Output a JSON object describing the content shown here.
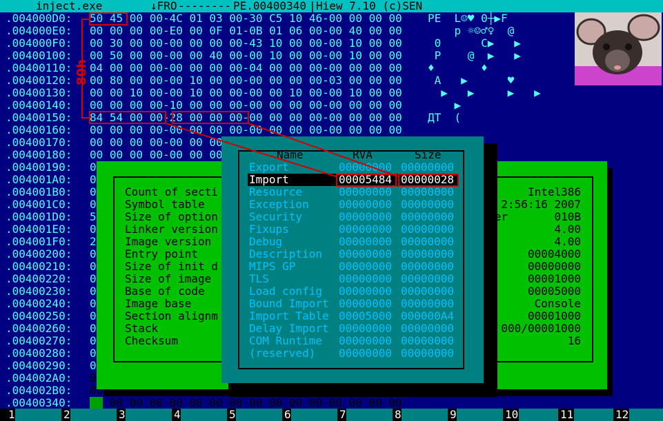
{
  "titlebar": {
    "file": "inject.exe",
    "mode": "↓FRO",
    "dashes": "--------",
    "position": "PE.00400340",
    "app": "Hiew 7.10 (c)SEN"
  },
  "hex_rows": [
    {
      "addr": ".004000D0:",
      "hex": "50 45 00 00-4C 01 03 00-30 C5 10 46-00 00 00 00",
      "ascii": "PE  L☺♥ 0┼▶F"
    },
    {
      "addr": ".004000E0:",
      "hex": "00 00 00 00-E0 00 0F 01-0B 01 06 00-00 40 00 00",
      "ascii": "    p ☼☺♂♀  @"
    },
    {
      "addr": ".004000F0:",
      "hex": "00 30 00 00-00 00 00 00-43 10 00 00-00 10 00 00",
      "ascii": " 0      C▶   ▶"
    },
    {
      "addr": ".00400100:",
      "hex": "00 50 00 00-00 00 40 00-00 10 00 00-00 10 00 00",
      "ascii": " P    @  ▶   ▶"
    },
    {
      "addr": ".00400110:",
      "hex": "04 00 00 00-00 00 00 00-04 00 00 00-00 00 00 00",
      "ascii": "♦       ♦"
    },
    {
      "addr": ".00400120:",
      "hex": "00 80 00 00-00 10 00 00-00 00 00 00-03 00 00 00",
      "ascii": " А   ▶      ♥"
    },
    {
      "addr": ".00400130:",
      "hex": "00 00 10 00-00 10 00 00-00 00 10 00-00 10 00 00",
      "ascii": "  ▶   ▶     ▶   ▶"
    },
    {
      "addr": ".00400140:",
      "hex": "00 00 00 00-10 00 00 00-00 00 00 00-00 00 00 00",
      "ascii": "    ▶"
    },
    {
      "addr": ".00400150:",
      "hex": "84 54 00 00-28 00 00 00-00 00 00 00-00 00 00 00",
      "ascii": "ДT  ("
    },
    {
      "addr": ".00400160:",
      "hex": "00 00 00 00-00 00 00 00-00 00 00 00-00 00 00 00",
      "ascii": ""
    },
    {
      "addr": ".00400170:",
      "hex": "00 00 00 00-00 00 00 00",
      "ascii": ""
    },
    {
      "addr": ".00400180:",
      "hex": "00 00 00 00-00 00 00 00",
      "ascii": ""
    },
    {
      "addr": ".00400190:",
      "hex": "0",
      "ascii": ""
    },
    {
      "addr": ".004001A0:",
      "hex": "0",
      "ascii": ""
    },
    {
      "addr": ".004001B0:",
      "hex": "0",
      "ascii": ""
    },
    {
      "addr": ".004001C0:",
      "hex": "0",
      "ascii": ""
    },
    {
      "addr": ".004001D0:",
      "hex": "5",
      "ascii": ""
    },
    {
      "addr": ".004001E0:",
      "hex": "0",
      "ascii": ""
    },
    {
      "addr": ".004001F0:",
      "hex": "2",
      "ascii": ""
    },
    {
      "addr": ".00400200:",
      "hex": "0",
      "ascii": ""
    },
    {
      "addr": ".00400210:",
      "hex": "0",
      "ascii": ""
    },
    {
      "addr": ".00400220:",
      "hex": "0",
      "ascii": ""
    },
    {
      "addr": ".00400230:",
      "hex": "0",
      "ascii": ""
    },
    {
      "addr": ".00400240:",
      "hex": "0",
      "ascii": ""
    },
    {
      "addr": ".00400250:",
      "hex": "0",
      "ascii": ""
    },
    {
      "addr": ".00400260:",
      "hex": "0",
      "ascii": ""
    },
    {
      "addr": ".00400270:",
      "hex": "0",
      "ascii": ""
    },
    {
      "addr": ".00400280:",
      "hex": "0",
      "ascii": ""
    },
    {
      "addr": ".00400290:",
      "hex": "0",
      "ascii": ""
    },
    {
      "addr": ".004002A0:",
      "hex": "00 00 00 00-00 00 00 00",
      "ascii": ""
    },
    {
      "addr": ".004002B0:",
      "hex": "00 00 00 00-00 00 00 00-00 00 00 00-00 00 00 00",
      "ascii": ""
    },
    {
      "addr": ".00400340:",
      "hex": "00 00 00 00-00 00 00 00-00 00 00 00-00 00 00 00",
      "ascii": ""
    }
  ],
  "annotation": {
    "offset_label": "80h"
  },
  "pe_header": {
    "labels": [
      "Count of secti",
      "Symbol table",
      "Size of option",
      "Linker version",
      "Image version",
      "Entry point",
      "Size of init d",
      "Size of image",
      "Base of code",
      "Image base",
      "Section alignm",
      "Stack",
      "Checksum"
    ],
    "values": [
      "Intel386",
      "2:56:16 2007",
      "er       010B",
      "4.00",
      "4.00",
      "00004000",
      "00000000",
      "00001000",
      "00005000",
      "Console",
      "00001000",
      "000/00001000",
      "16"
    ]
  },
  "data_directory": {
    "headers": {
      "name": "Name",
      "rva": "RVA",
      "size": "Size"
    },
    "rows": [
      {
        "name": "Export",
        "rva": "00000000",
        "size": "00000000"
      },
      {
        "name": "Import",
        "rva": "00005484",
        "size": "00000028"
      },
      {
        "name": "Resource",
        "rva": "00000000",
        "size": "00000000"
      },
      {
        "name": "Exception",
        "rva": "00000000",
        "size": "00000000"
      },
      {
        "name": "Security",
        "rva": "00000000",
        "size": "00000000"
      },
      {
        "name": "Fixups",
        "rva": "00000000",
        "size": "00000000"
      },
      {
        "name": "Debug",
        "rva": "00000000",
        "size": "00000000"
      },
      {
        "name": "Description",
        "rva": "00000000",
        "size": "00000000"
      },
      {
        "name": "MIPS GP",
        "rva": "00000000",
        "size": "00000000"
      },
      {
        "name": "TLS",
        "rva": "00000000",
        "size": "00000000"
      },
      {
        "name": "Load config",
        "rva": "00000000",
        "size": "00000000"
      },
      {
        "name": "Bound Import",
        "rva": "00000000",
        "size": "00000000"
      },
      {
        "name": "Import Table",
        "rva": "00005000",
        "size": "000000A4"
      },
      {
        "name": "Delay Import",
        "rva": "00000000",
        "size": "00000000"
      },
      {
        "name": "COM Runtime",
        "rva": "00000000",
        "size": "00000000"
      },
      {
        "name": "(reserved)",
        "rva": "00000000",
        "size": "00000000"
      }
    ],
    "selected_index": 1
  },
  "fkeys": [
    "1",
    "2",
    "3",
    "4",
    "5",
    "6",
    "7",
    "8",
    "9",
    "10",
    "11",
    "12"
  ],
  "colors": {
    "background": "#000080",
    "hex_text": "#55ffff",
    "titlebar": "#00c0c0",
    "dialog_green": "#00c000",
    "dialog_teal": "#008080",
    "annotation_red": "#d00000"
  },
  "icons": {
    "thumbnail": "rat-photo-icon"
  }
}
